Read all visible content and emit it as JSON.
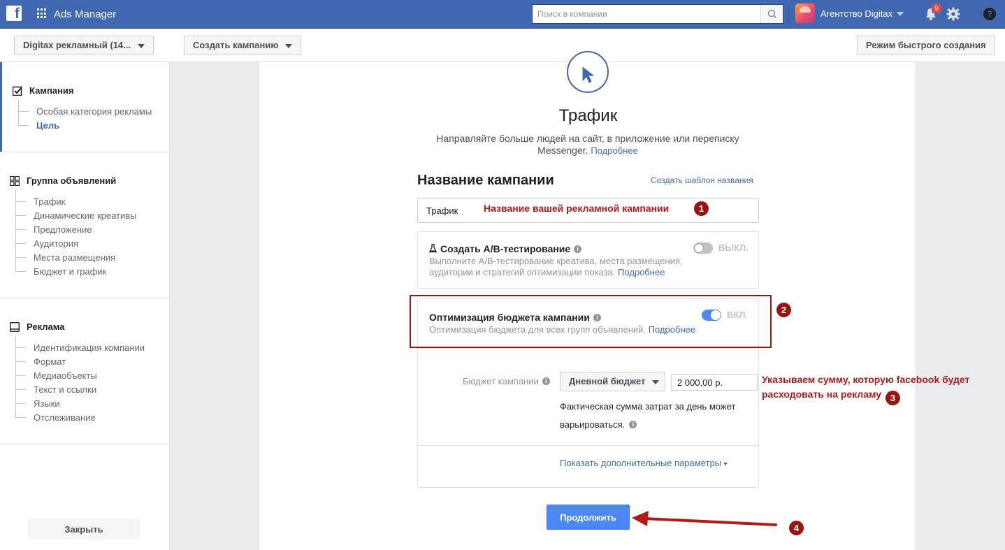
{
  "app": {
    "title": "Ads Manager"
  },
  "topbar": {
    "search_placeholder": "Поиск в компании",
    "agency_name": "Агентство Digitax",
    "notification_count": "9",
    "help_label": "?"
  },
  "toolbar": {
    "account_label": "Digitax рекламный (14...",
    "create_campaign_label": "Создать кампанию",
    "quick_create_label": "Режим быстрого создания"
  },
  "sidebar": {
    "campaign": {
      "title": "Кампания",
      "items": [
        "Особая категория рекламы",
        "Цель"
      ],
      "active_index": 1
    },
    "adset": {
      "title": "Группа объявлений",
      "items": [
        "Трафик",
        "Динамические креативы",
        "Предложение",
        "Аудитория",
        "Места размещения",
        "Бюджет и график"
      ]
    },
    "ad": {
      "title": "Реклама",
      "items": [
        "Идентификация компании",
        "Формат",
        "Медиаобъекты",
        "Текст и ссылки",
        "Языки",
        "Отслеживание"
      ]
    },
    "close_label": "Закрыть"
  },
  "main": {
    "objective_title": "Трафик",
    "objective_desc": "Направляйте больше людей на сайт, в приложение или переписку Messenger.",
    "objective_more": "Подробнее",
    "section_title": "Название кампании",
    "template_link": "Создать шаблон названия",
    "campaign_name_value": "Трафик",
    "ab_test": {
      "title": "Создать A/B-тестирование",
      "desc": "Выполните A/B-тестирование креатива, места размещения, аудитории и стратегий оптимизации показа.",
      "more": "Подробнее",
      "state_label": "ВЫКЛ.",
      "enabled": false
    },
    "cbo": {
      "title": "Оптимизация бюджета кампании",
      "desc": "Оптимизация бюджета для всех групп объявлений.",
      "more": "Подробнее",
      "state_label": "ВКЛ.",
      "enabled": true
    },
    "budget": {
      "label": "Бюджет кампании",
      "type_selected": "Дневной бюджет",
      "amount": "2 000,00 р.",
      "note": "Фактическая сумма затрат за день может варьироваться."
    },
    "show_more": "Показать дополнительные параметры",
    "continue_label": "Продолжить"
  },
  "annotations": {
    "a1_text": "Название вашей рекламной кампании",
    "a1_num": "1",
    "a2_num": "2",
    "a3_line1": "Указываем сумму, которую facebook будет",
    "a3_line2": "расходовать на рекламу",
    "a3_num": "3",
    "a4_num": "4",
    "accent_color": "#9b1414"
  },
  "colors": {
    "brand": "#4267b2",
    "primary_button": "#4b87f5",
    "toggle_on": "#4b87f5",
    "toggle_off": "#bec3c9"
  },
  "icons": {
    "logo": "facebook-logo-icon",
    "apps": "apps-grid-icon",
    "search": "search-icon",
    "bell": "bell-icon",
    "gear": "gear-icon",
    "help": "help-icon",
    "objective": "cursor-icon"
  }
}
